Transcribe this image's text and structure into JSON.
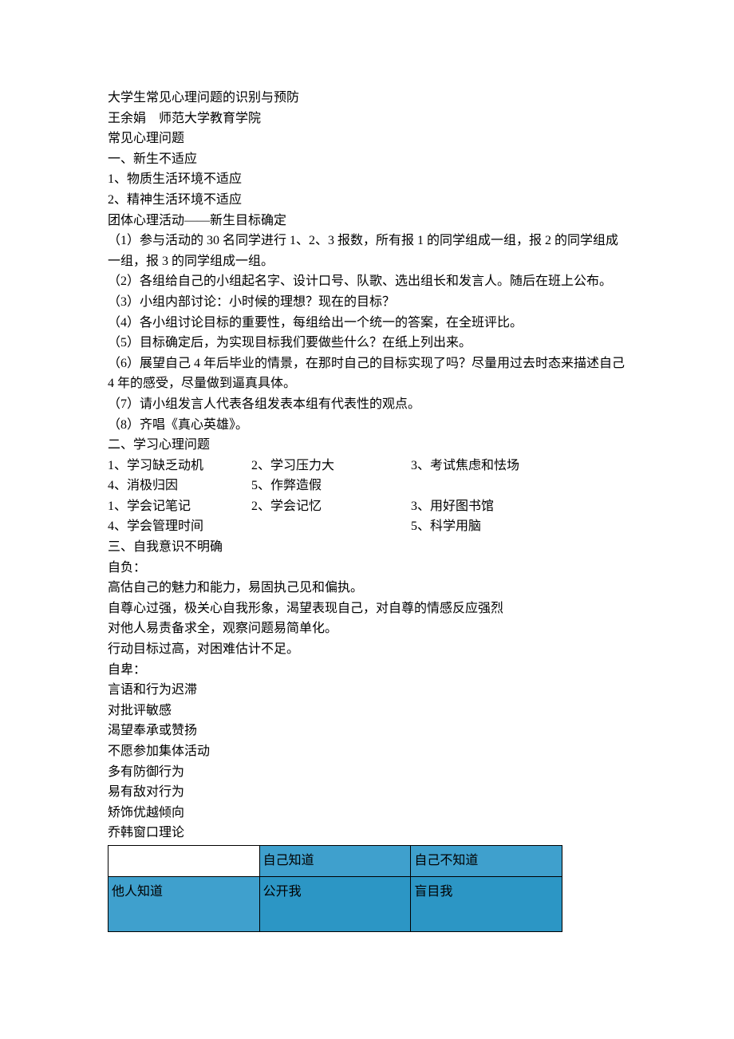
{
  "title": "大学生常见心理问题的识别与预防",
  "author_line": "王余娟　师范大学教育学院",
  "section_common": "常见心理问题",
  "s1": {
    "heading": "一、新生不适应",
    "items": [
      "1、物质生活环境不适应",
      "2、精神生活环境不适应"
    ],
    "activity_title": "团体心理活动——新生目标确定",
    "steps": [
      "（1）参与活动的 30 名同学进行 1、2、3 报数，所有报 1 的同学组成一组，报 2 的同学组成一组，报 3 的同学组成一组。",
      "（2）各组给自己的小组起名字、设计口号、队歌、选出组长和发言人。随后在班上公布。",
      "（3）小组内部讨论：小时候的理想？现在的目标？",
      "（4）各小组讨论目标的重要性，每组给出一个统一的答案，在全班评比。",
      "（5）目标确定后，为实现目标我们要做些什么？在纸上列出来。",
      "（6）展望自己 4 年后毕业的情景，在那时自己的目标实现了吗？尽量用过去时态来描述自己 4 年的感受，尽量做到逼真具体。",
      "（7）请小组发言人代表各组发表本组有代表性的观点。",
      "（8）齐唱《真心英雄》。"
    ]
  },
  "s2": {
    "heading": "二、学习心理问题",
    "row1": {
      "a": "1、学习缺乏动机",
      "b": "2、学习压力大",
      "c": "3、考试焦虑和怯场"
    },
    "row2": {
      "a": "4、消极归因",
      "b": "5、作弊造假",
      "c": ""
    },
    "row3": {
      "a": "1、学会记笔记",
      "b": "2、学会记忆",
      "c": "3、用好图书馆"
    },
    "row4": {
      "a": "4、学会管理时间",
      "b": "",
      "c": "5、科学用脑"
    }
  },
  "s3": {
    "heading": "三、自我意识不明确",
    "conceit_label": "自负：",
    "conceit_points": [
      "高估自己的魅力和能力，易固执己见和偏执。",
      "自尊心过强，极关心自我形象，渴望表现自己，对自尊的情感反应强烈",
      "对他人易责备求全，观察问题易简单化。",
      "行动目标过高，对困难估计不足。"
    ],
    "inferior_label": "自卑：",
    "inferior_points": [
      "言语和行为迟滞",
      "对批评敏感",
      "渴望奉承或赞扬",
      "不愿参加集体活动",
      "多有防御行为",
      "易有敌对行为",
      "矫饰优越倾向"
    ],
    "johari_title": "乔韩窗口理论",
    "johari": {
      "col1": "自己知道",
      "col2": "自己不知道",
      "rowlabel": "他人知道",
      "cell1": "公开我",
      "cell2": "盲目我"
    }
  }
}
